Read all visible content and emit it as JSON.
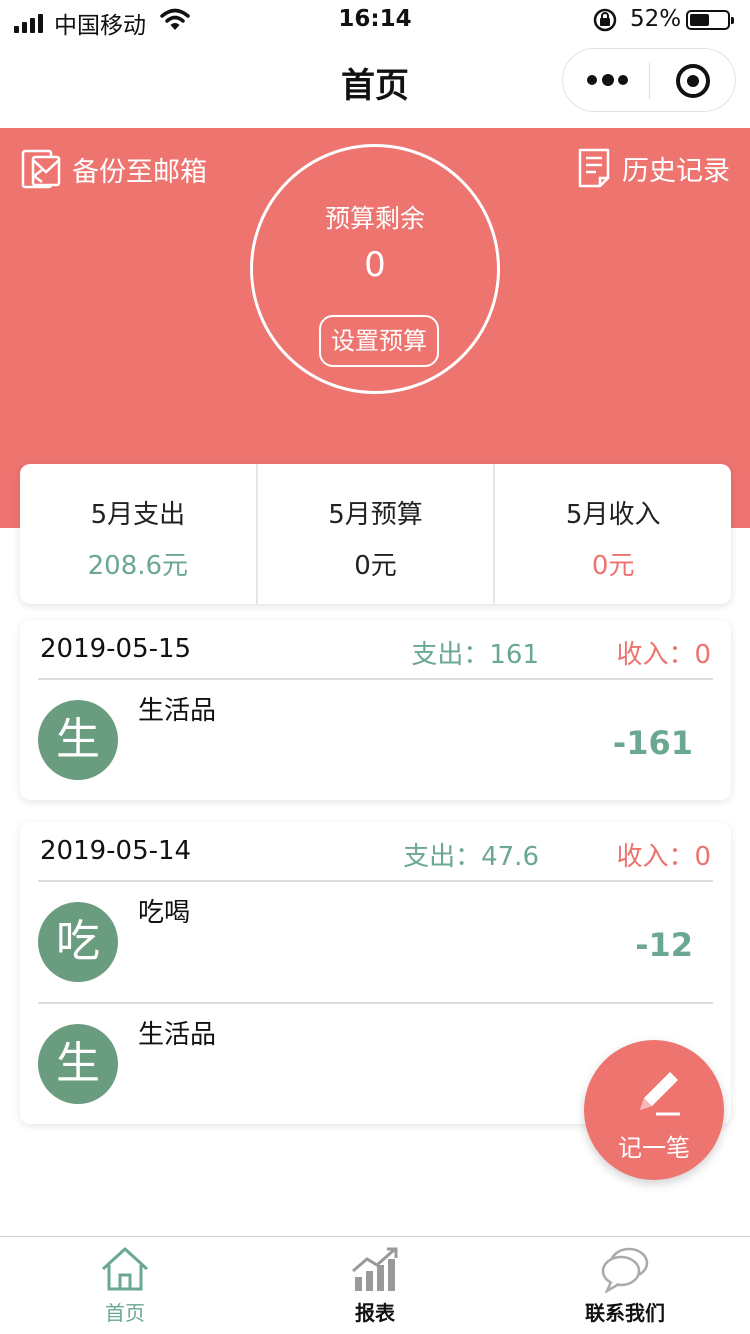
{
  "status_bar": {
    "carrier": "中国移动",
    "time": "16:14",
    "battery": "52%",
    "battery_level": 0.52
  },
  "nav": {
    "title": "首页"
  },
  "hero": {
    "backup_label": "备份至邮箱",
    "history_label": "历史记录",
    "budget_label": "预算剩余",
    "budget_value": "0",
    "set_budget_label": "设置预算"
  },
  "summary": [
    {
      "label": "5月支出",
      "value": "208.6元",
      "color": "#6aa88f"
    },
    {
      "label": "5月预算",
      "value": "0元",
      "color": "#222222"
    },
    {
      "label": "5月收入",
      "value": "0元",
      "color": "#ec7370"
    }
  ],
  "days": [
    {
      "date": "2019-05-15",
      "expense": "支出：161",
      "income": "收入：0",
      "entries": [
        {
          "avatar": "生",
          "name": "生活品",
          "amount": "-161"
        }
      ]
    },
    {
      "date": "2019-05-14",
      "expense": "支出：47.6",
      "income": "收入：0",
      "entries": [
        {
          "avatar": "吃",
          "name": "吃喝",
          "amount": "-12"
        },
        {
          "avatar": "生",
          "name": "生活品",
          "amount": ""
        }
      ]
    }
  ],
  "fab": {
    "label": "记一笔",
    "icon": "pencil-icon"
  },
  "tabs": [
    {
      "label": "首页",
      "icon": "home-icon"
    },
    {
      "label": "报表",
      "icon": "chart-icon"
    },
    {
      "label": "联系我们",
      "icon": "chat-icon"
    }
  ],
  "colors": {
    "accent": "#ee7470",
    "expense": "#6aa88f",
    "income": "#ec7370",
    "avatar": "#6a9c80"
  }
}
